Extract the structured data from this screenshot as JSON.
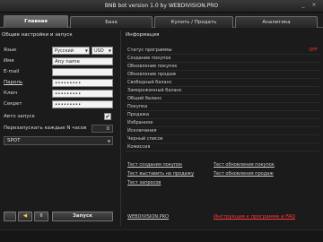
{
  "window": {
    "title": "BNB bot version 1.0 by WEBDIVISION.PRO",
    "minimize": "_",
    "close": "×"
  },
  "tabs": [
    "Главная",
    "База",
    "Купить / Продать",
    "Аналитика"
  ],
  "left": {
    "title": "Общие настройки и запуск",
    "language_label": "Язык",
    "language_value": "Русский",
    "currency_value": "USD",
    "name_label": "Имя",
    "name_value": "Any name",
    "email_label": "E-mail",
    "email_value": "",
    "password_label": "Пароль",
    "password_value": "•••••••••",
    "key_label": "Ключ",
    "key_value": "•••••••••",
    "secret_label": "Секрет",
    "secret_value": "•••••••••",
    "autostart_label": "Авто запуск",
    "autostart_checked": "✔",
    "restart_label": "Перезапускать каждые N часов",
    "restart_value": "0",
    "mode_value": "SPOT",
    "buttons": {
      "b1": "",
      "b2": "◀",
      "b3": "II",
      "start": "Запуск"
    }
  },
  "right": {
    "title": "Информация",
    "rows": [
      {
        "k": "Статус программы",
        "v": "OFF"
      },
      {
        "k": "Создание покупок",
        "v": ""
      },
      {
        "k": "Обновление покупок",
        "v": ""
      },
      {
        "k": "Обновление продаж",
        "v": ""
      },
      {
        "k": "Свободный баланс",
        "v": ""
      },
      {
        "k": "Замороженный баланс",
        "v": ""
      },
      {
        "k": "Общий баланс",
        "v": ""
      },
      {
        "k": "Покупка",
        "v": ""
      },
      {
        "k": "Продажа",
        "v": ""
      },
      {
        "k": "Избранное",
        "v": ""
      },
      {
        "k": "Исключения",
        "v": ""
      },
      {
        "k": "Черный список",
        "v": ""
      },
      {
        "k": "Комиссия",
        "v": ""
      }
    ],
    "links": {
      "test_create_buy": "Тест создания покупок",
      "test_update_buy": "Тест обновления покупок",
      "test_place_sell": "Тест выставить на продажу",
      "test_update_sell": "Тест обновления продаж",
      "test_logs": "Тест запросов"
    },
    "footer_site": "WEBDIVISION.PRO",
    "footer_help": "Инструкция к программе и FAQ"
  }
}
